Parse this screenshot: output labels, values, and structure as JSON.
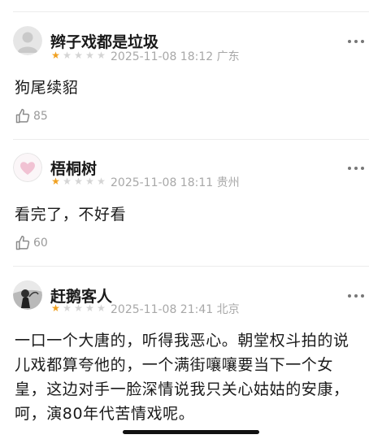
{
  "comments": [
    {
      "username": "辫子戏都是垃圾",
      "rating": 1,
      "meta": "2025-11-08 18:12 广东",
      "text": "狗尾续貂",
      "likes": "85"
    },
    {
      "username": "梧桐树",
      "rating": 1,
      "meta": "2025-11-08 18:11 贵州",
      "text": "看完了，不好看",
      "likes": "60"
    },
    {
      "username": "赶鹅客人",
      "rating": 1,
      "meta": "2025-11-08 21:41 北京",
      "text": "一口一个大唐的，听得我恶心。朝堂权斗拍的说儿戏都算夸他的，一个满街嚷嚷要当下一个女皇，这边对手一脸深情说我只关心姑姑的安康，呵，演80年代苦情戏呢。",
      "likes": ""
    }
  ],
  "icons": {
    "rating_star": "star-icon",
    "like": "thumbs-up-icon",
    "more": "more-options-icon"
  },
  "colors": {
    "star_on": "#f0a020",
    "star_off": "#d4d4d4",
    "meta_text": "#a8a8a8"
  }
}
